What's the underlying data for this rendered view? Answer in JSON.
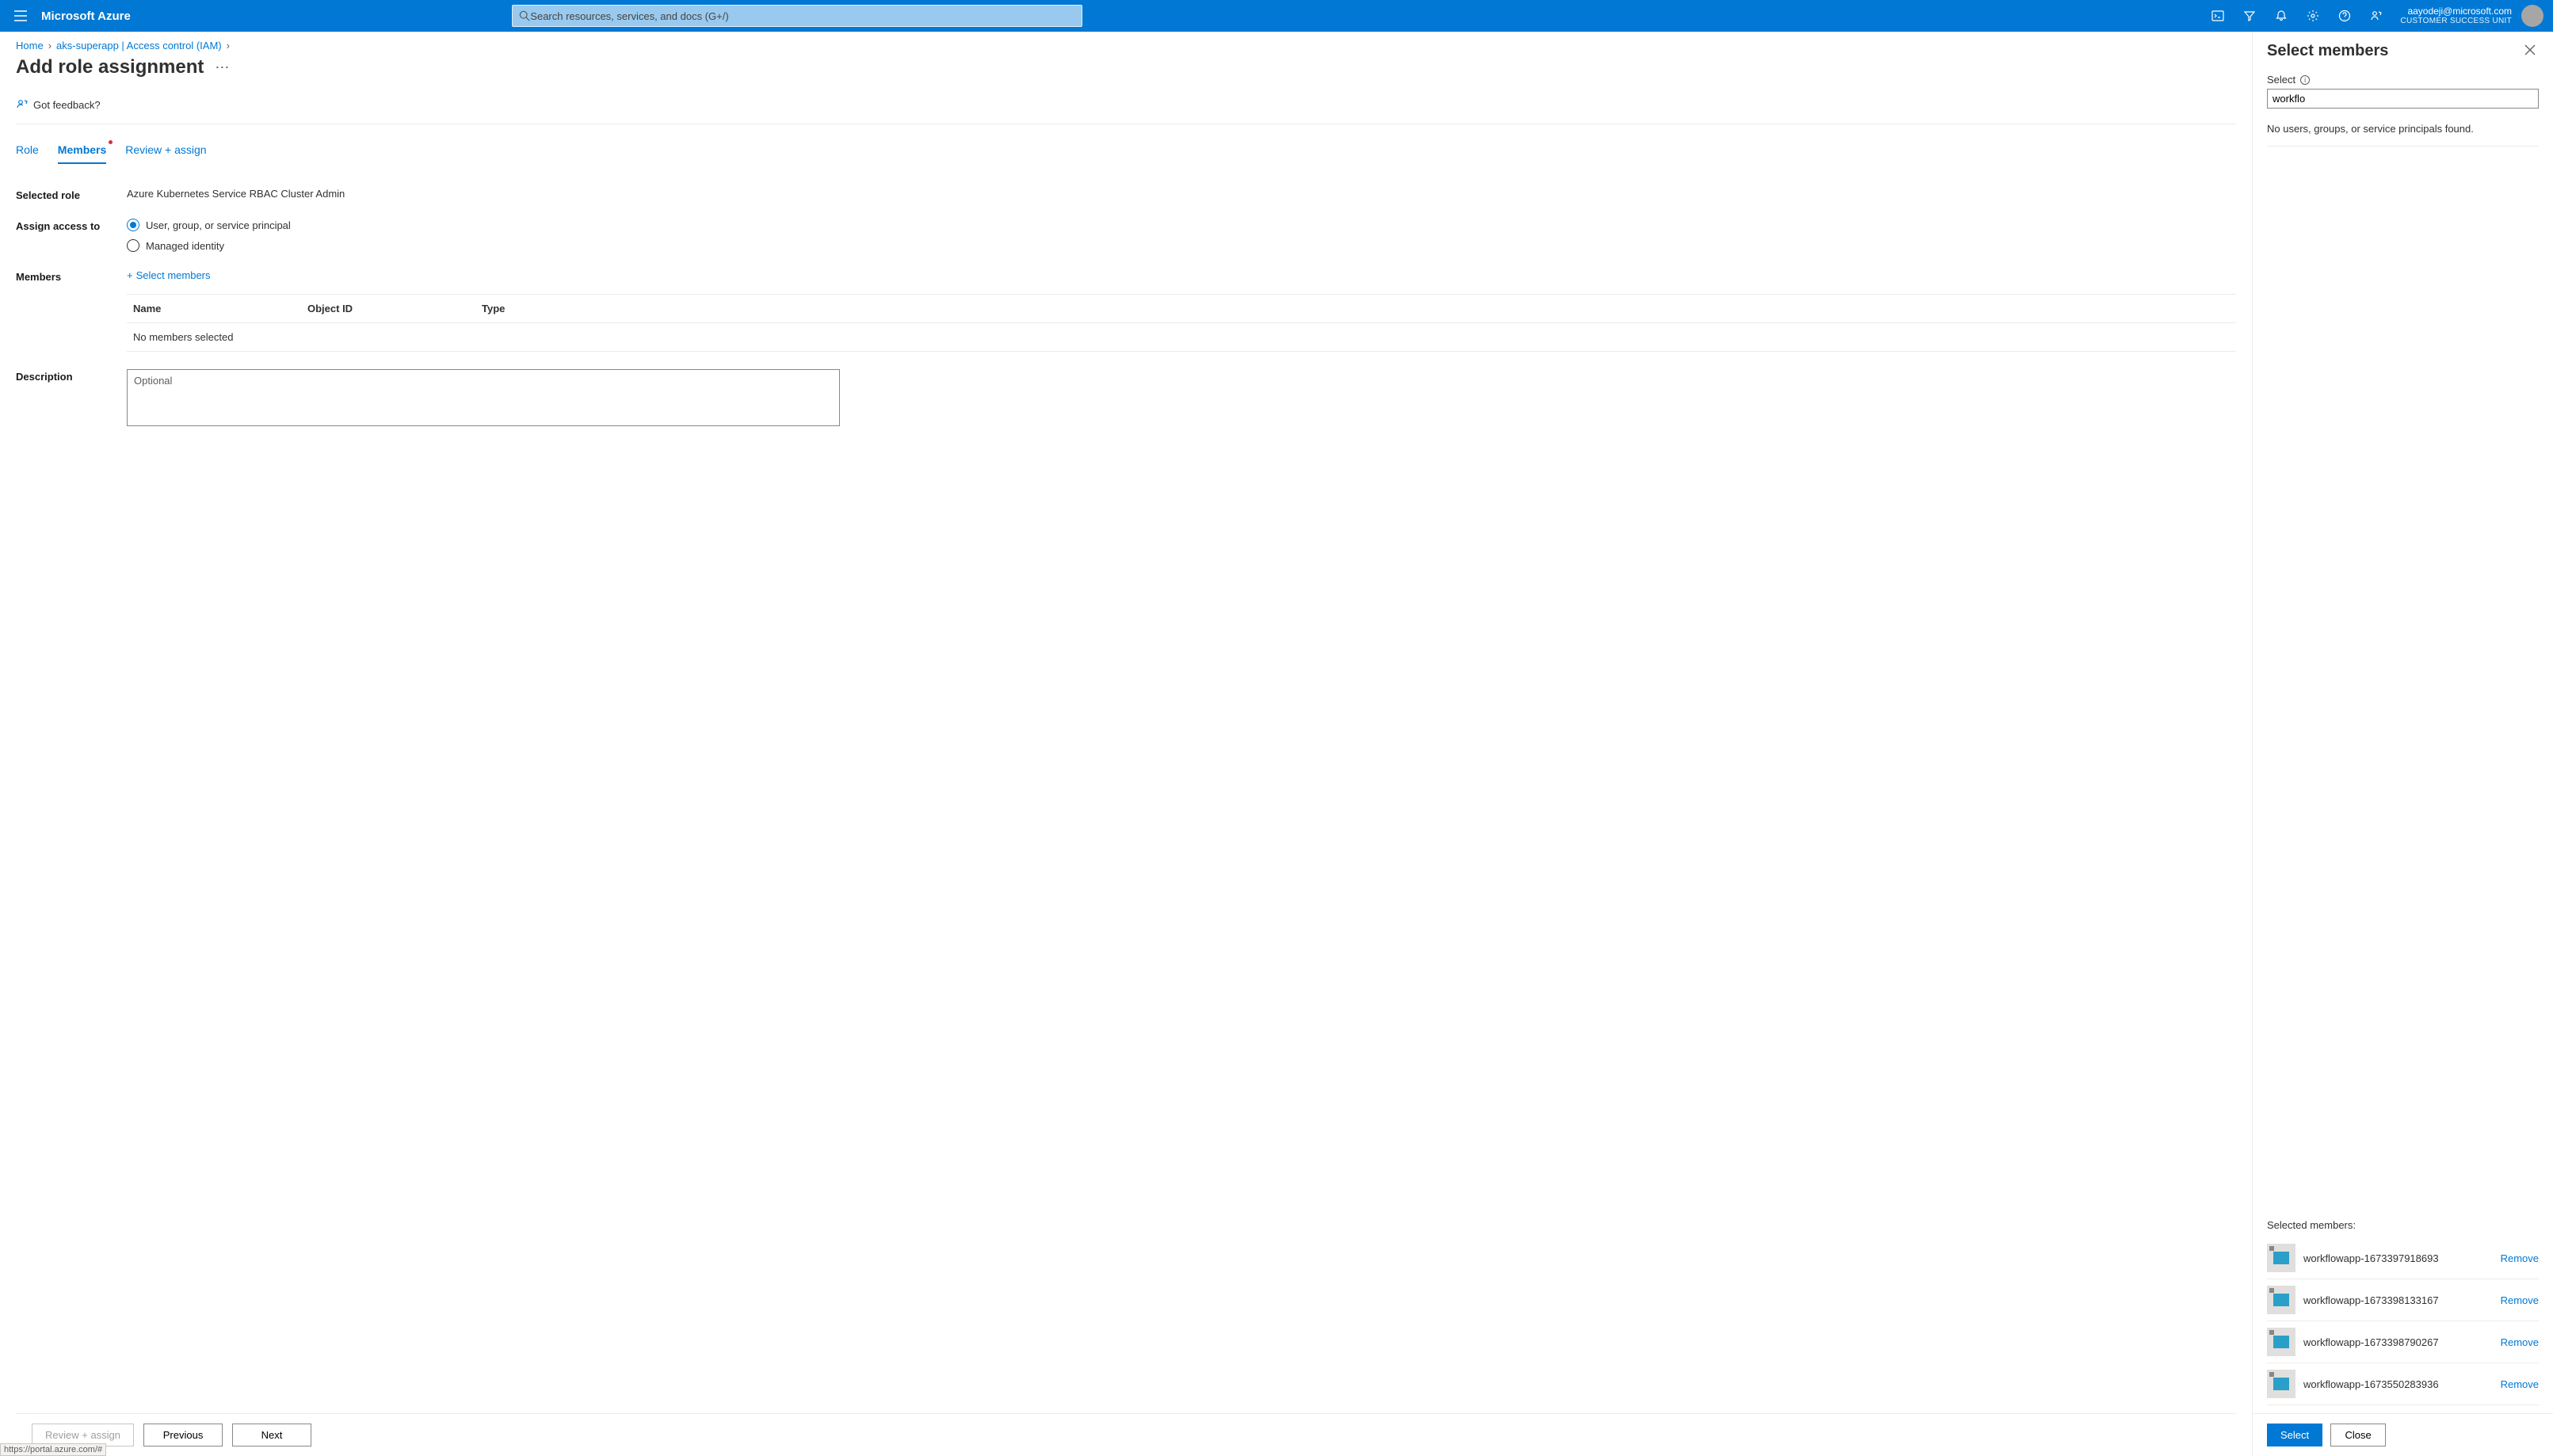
{
  "header": {
    "brand": "Microsoft Azure",
    "search_placeholder": "Search resources, services, and docs (G+/)",
    "account_email": "aayodeji@microsoft.com",
    "account_unit": "CUSTOMER SUCCESS UNIT"
  },
  "breadcrumb": {
    "home": "Home",
    "resource": "aks-superapp | Access control (IAM)"
  },
  "page": {
    "title": "Add role assignment",
    "feedback": "Got feedback?"
  },
  "tabs": {
    "role": "Role",
    "members": "Members",
    "review": "Review + assign"
  },
  "form": {
    "selected_role_label": "Selected role",
    "selected_role_value": "Azure Kubernetes Service RBAC Cluster Admin",
    "assign_access_label": "Assign access to",
    "assign_opt1": "User, group, or service principal",
    "assign_opt2": "Managed identity",
    "members_label": "Members",
    "select_members_link": "Select members",
    "table": {
      "name": "Name",
      "object_id": "Object ID",
      "type": "Type",
      "empty": "No members selected"
    },
    "description_label": "Description",
    "description_placeholder": "Optional"
  },
  "bottom": {
    "review": "Review + assign",
    "previous": "Previous",
    "next": "Next"
  },
  "panel": {
    "title": "Select members",
    "select_label": "Select",
    "search_value": "workflo",
    "no_results": "No users, groups, or service principals found.",
    "selected_header": "Selected members:",
    "remove": "Remove",
    "members": [
      {
        "name": "workflowapp-1673397918693"
      },
      {
        "name": "workflowapp-1673398133167"
      },
      {
        "name": "workflowapp-1673398790267"
      },
      {
        "name": "workflowapp-1673550283936"
      }
    ],
    "select_btn": "Select",
    "close_btn": "Close"
  },
  "status_url": "https://portal.azure.com/#"
}
